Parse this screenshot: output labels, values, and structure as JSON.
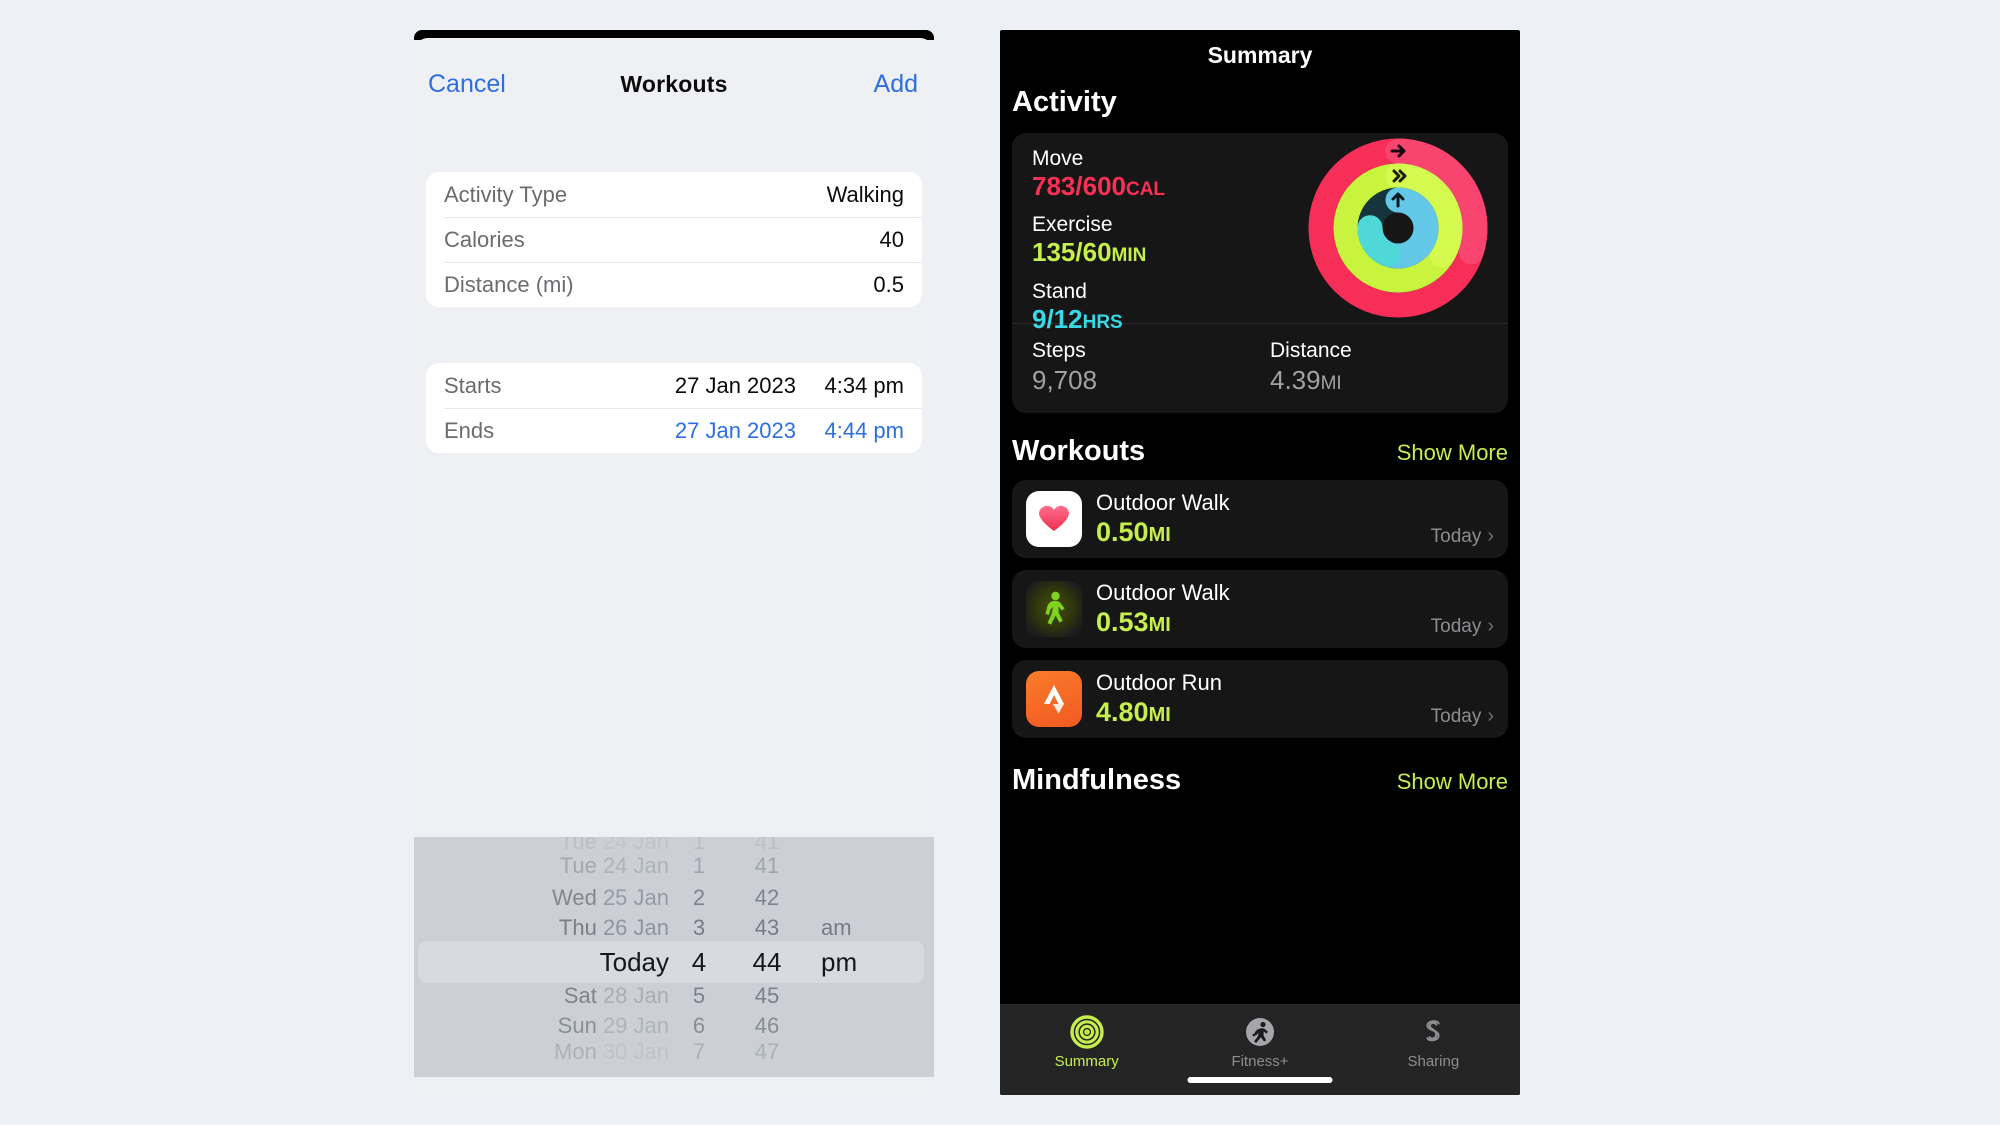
{
  "theme": {
    "page_bg": "#edf0f4",
    "ios_blue": "#2d6fe0",
    "move_color": "#fa2f55",
    "exercise_color": "#c6ef4e",
    "stand_color": "#3ad8e6",
    "dark_card": "#161616"
  },
  "left_phone": {
    "nav": {
      "cancel_label": "Cancel",
      "title": "Workouts",
      "add_label": "Add"
    },
    "details_card": {
      "rows": [
        {
          "label": "Activity Type",
          "value": "Walking"
        },
        {
          "label": "Calories",
          "value": "40"
        },
        {
          "label": "Distance (mi)",
          "value": "0.5"
        }
      ]
    },
    "schedule_card": {
      "rows": [
        {
          "label": "Starts",
          "date": "27 Jan 2023",
          "time": "4:34 pm",
          "active": false
        },
        {
          "label": "Ends",
          "date": "27 Jan 2023",
          "time": "4:44 pm",
          "active": true
        }
      ]
    },
    "date_picker": {
      "rows": [
        {
          "weekday": "Tue",
          "date": "24 Jan",
          "hour": "1",
          "minute": "41",
          "ampm": "",
          "selected": false
        },
        {
          "weekday": "Wed",
          "date": "25 Jan",
          "hour": "2",
          "minute": "42",
          "ampm": "",
          "selected": false
        },
        {
          "weekday": "Thu",
          "date": "26 Jan",
          "hour": "3",
          "minute": "43",
          "ampm": "am",
          "selected": false
        },
        {
          "weekday": "",
          "date": "Today",
          "hour": "4",
          "minute": "44",
          "ampm": "pm",
          "selected": true
        },
        {
          "weekday": "Sat",
          "date": "28 Jan",
          "hour": "5",
          "minute": "45",
          "ampm": "",
          "selected": false
        },
        {
          "weekday": "Sun",
          "date": "29 Jan",
          "hour": "6",
          "minute": "46",
          "ampm": "",
          "selected": false
        },
        {
          "weekday": "Mon",
          "date": "30 Jan",
          "hour": "7",
          "minute": "47",
          "ampm": "",
          "selected": false
        }
      ]
    }
  },
  "right_phone": {
    "nav_title": "Summary",
    "activity": {
      "heading": "Activity",
      "rings": [
        {
          "name": "Move",
          "value": "783/600",
          "unit": "CAL",
          "current": 783,
          "goal": 600,
          "color": "#fa2f55"
        },
        {
          "name": "Exercise",
          "value": "135/60",
          "unit": "MIN",
          "current": 135,
          "goal": 60,
          "color": "#c6ef4e"
        },
        {
          "name": "Stand",
          "value": "9/12",
          "unit": "HRS",
          "current": 9,
          "goal": 12,
          "color": "#3ad8e6"
        }
      ],
      "stats": [
        {
          "name": "Steps",
          "value": "9,708",
          "unit": ""
        },
        {
          "name": "Distance",
          "value": "4.39",
          "unit": "MI"
        }
      ]
    },
    "workouts": {
      "heading": "Workouts",
      "show_more": "Show More",
      "items": [
        {
          "icon": "heart-icon",
          "title": "Outdoor Walk",
          "distance": "0.50",
          "unit": "MI",
          "when": "Today"
        },
        {
          "icon": "walking-person-icon",
          "title": "Outdoor Walk",
          "distance": "0.53",
          "unit": "MI",
          "when": "Today"
        },
        {
          "icon": "strava-icon",
          "title": "Outdoor Run",
          "distance": "4.80",
          "unit": "MI",
          "when": "Today"
        }
      ]
    },
    "mindfulness": {
      "heading": "Mindfulness",
      "show_more": "Show More"
    },
    "tabbar": {
      "tabs": [
        {
          "icon": "activity-rings-icon",
          "label": "Summary",
          "active": true
        },
        {
          "icon": "running-person-icon",
          "label": "Fitness+",
          "active": false
        },
        {
          "icon": "sharing-icon",
          "label": "Sharing",
          "active": false
        }
      ]
    }
  }
}
